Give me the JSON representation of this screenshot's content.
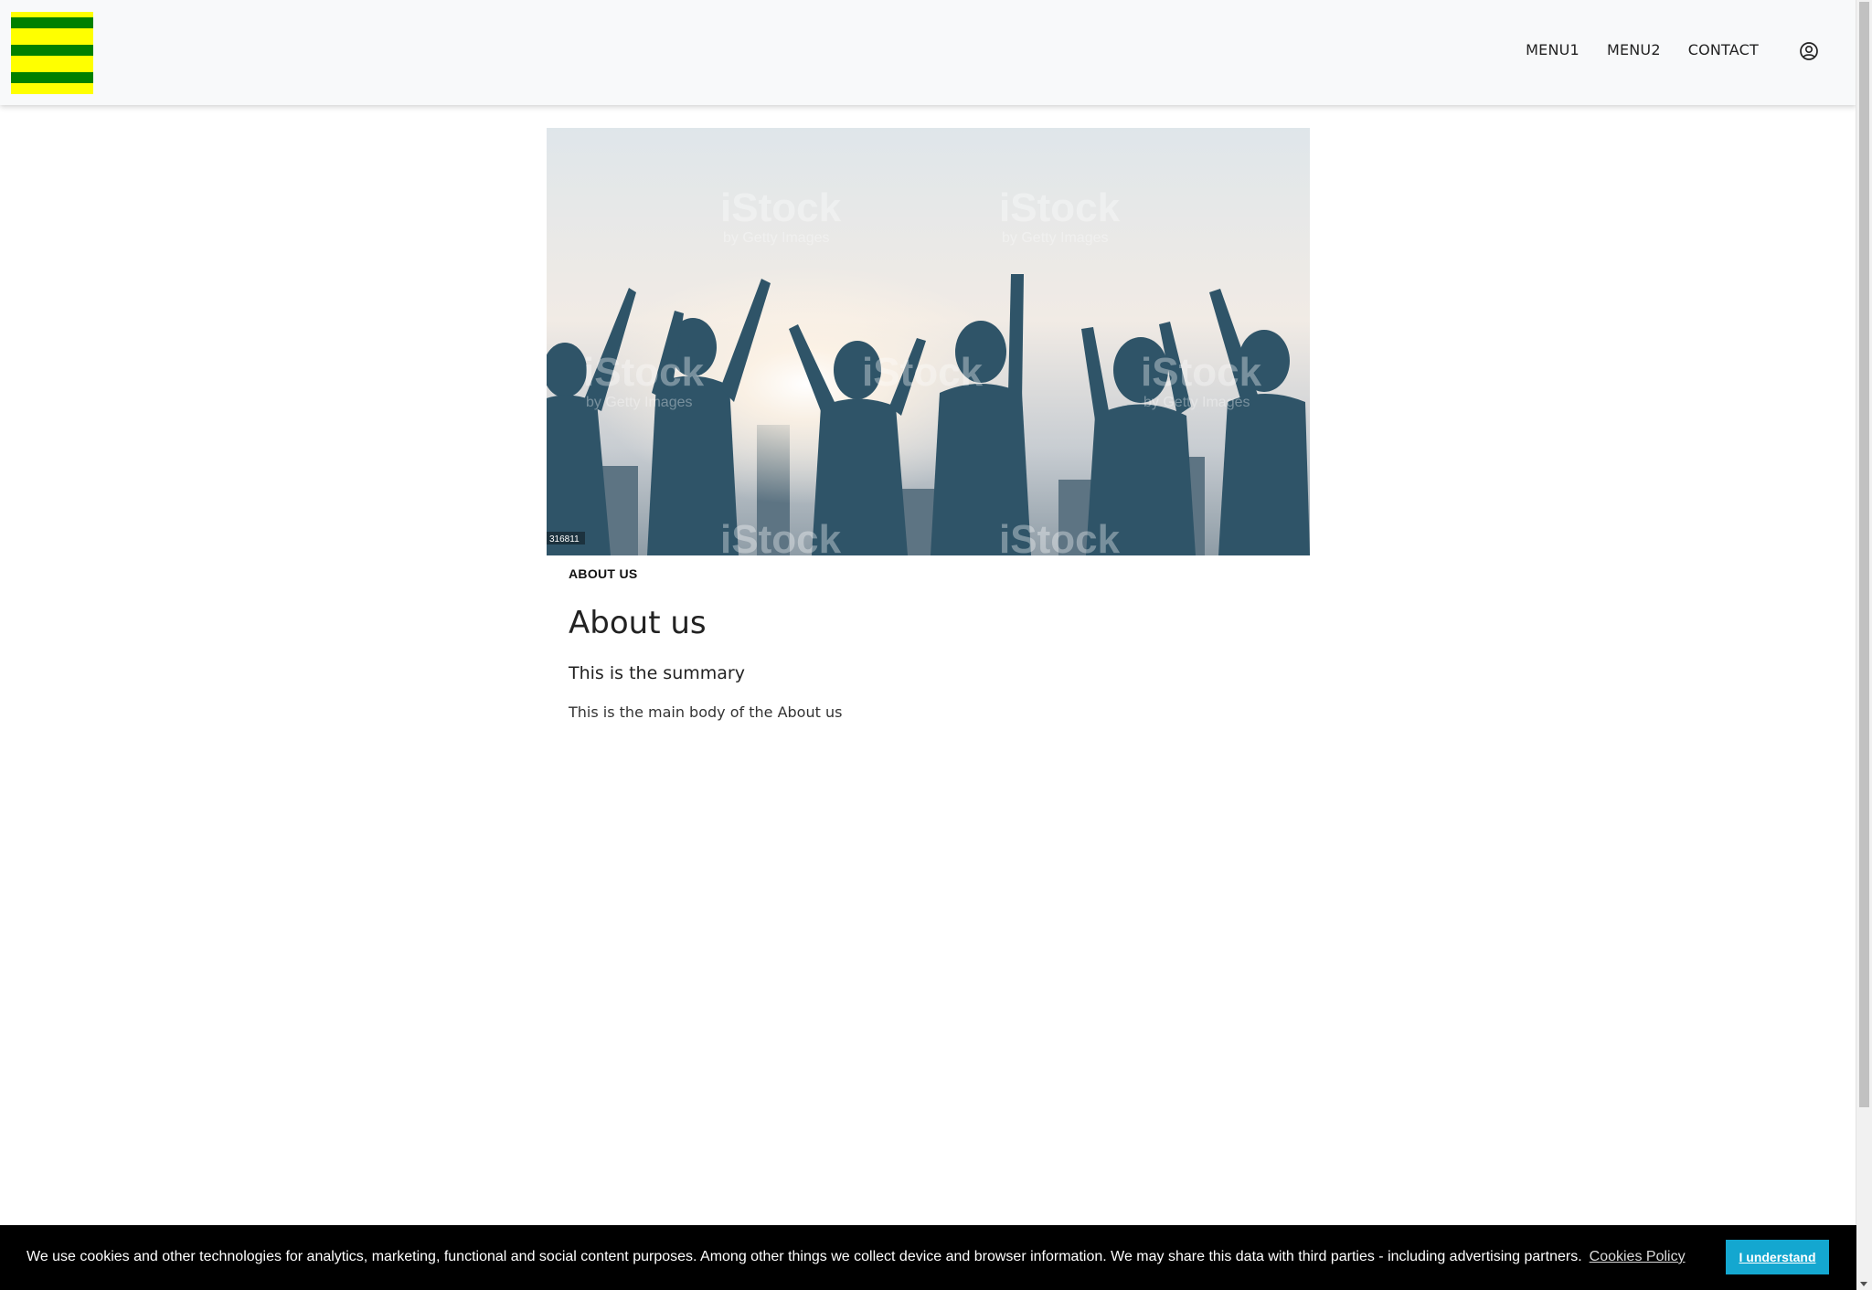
{
  "header": {
    "logo": "logo",
    "nav": [
      "MENU1",
      "MENU2",
      "CONTACT"
    ],
    "user_icon": "user-circle-icon"
  },
  "hero": {
    "alt": "hero-image",
    "watermark": "iStock",
    "watermark_sub": "by Getty Images",
    "image_id": "316811"
  },
  "content": {
    "breadcrumb": "ABOUT US",
    "title": "About us",
    "summary": "This is the summary",
    "body": "This is the main body of the About us"
  },
  "cookie": {
    "message": "We use cookies and other technologies for analytics, marketing, functional and social content purposes. Among other things we collect device and browser information. We may share this data with third parties - including advertising partners.",
    "policy_link": "Cookies Policy",
    "button": "I understand",
    "button_color": "#14a7d0"
  },
  "colors": {
    "logo_yellow": "#ffff00",
    "logo_green": "#008000",
    "header_bg": "#f8f9fa"
  }
}
